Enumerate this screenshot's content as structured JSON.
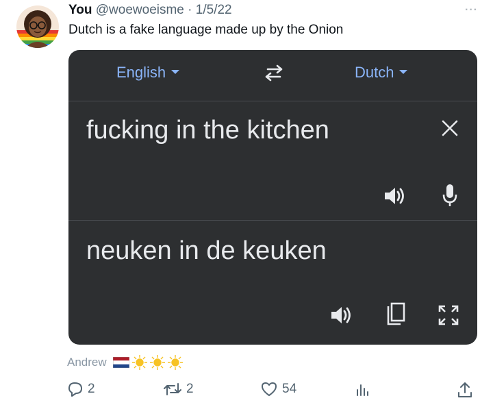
{
  "tweet": {
    "author_name": "You",
    "handle": "@woewoeisme",
    "separator": "·",
    "date": "1/5/22",
    "more_label": "···",
    "text": "Dutch is a fake language made up by the Onion"
  },
  "translate": {
    "source_language": "English",
    "target_language": "Dutch",
    "source_text": "fucking in the kitchen",
    "translated_text": "neuken in de keuken"
  },
  "reply_preview": {
    "name": "Andrew"
  },
  "actions": {
    "replies": "2",
    "retweets": "2",
    "likes": "54"
  },
  "colors": {
    "card_bg": "#2d2f31",
    "lang_blue": "#8ab4f8",
    "text_light": "#e8eaed",
    "action_gray": "#536471"
  }
}
